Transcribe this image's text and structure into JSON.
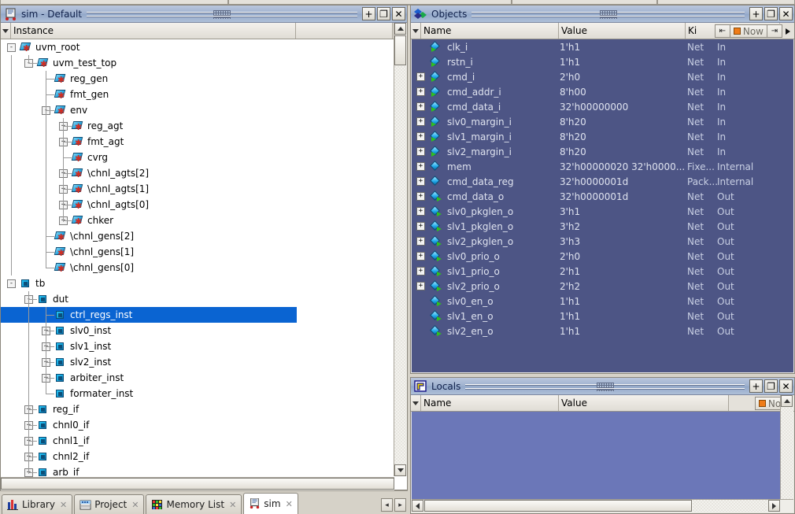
{
  "window": {
    "sim_panel": {
      "title": "sim - Default",
      "icon": "sim-waveform-icon",
      "buttons": [
        {
          "name": "dock-button",
          "glyph": "+"
        },
        {
          "name": "undock-button",
          "glyph": "❐"
        },
        {
          "name": "close-button",
          "glyph": "✕"
        }
      ],
      "columns": [
        "Instance",
        ""
      ],
      "tree": [
        {
          "label": "uvm_root",
          "depth": 0,
          "expander": "-",
          "icon": "uvm-class-icon"
        },
        {
          "label": "uvm_test_top",
          "depth": 1,
          "expander": "-",
          "icon": "uvm-class-icon"
        },
        {
          "label": "reg_gen",
          "depth": 2,
          "expander": "",
          "icon": "uvm-class-icon"
        },
        {
          "label": "fmt_gen",
          "depth": 2,
          "expander": "",
          "icon": "uvm-class-icon"
        },
        {
          "label": "env",
          "depth": 2,
          "expander": "-",
          "icon": "uvm-class-icon"
        },
        {
          "label": "reg_agt",
          "depth": 3,
          "expander": "+",
          "icon": "uvm-class-icon"
        },
        {
          "label": "fmt_agt",
          "depth": 3,
          "expander": "+",
          "icon": "uvm-class-icon"
        },
        {
          "label": "cvrg",
          "depth": 3,
          "expander": "",
          "icon": "uvm-class-icon"
        },
        {
          "label": "\\chnl_agts[2]",
          "depth": 3,
          "expander": "+",
          "icon": "uvm-class-icon"
        },
        {
          "label": "\\chnl_agts[1]",
          "depth": 3,
          "expander": "+",
          "icon": "uvm-class-icon"
        },
        {
          "label": "\\chnl_agts[0]",
          "depth": 3,
          "expander": "+",
          "icon": "uvm-class-icon"
        },
        {
          "label": "chker",
          "depth": 3,
          "expander": "+",
          "icon": "uvm-class-icon"
        },
        {
          "label": "\\chnl_gens[2]",
          "depth": 2,
          "expander": "",
          "icon": "uvm-class-icon"
        },
        {
          "label": "\\chnl_gens[1]",
          "depth": 2,
          "expander": "",
          "icon": "uvm-class-icon"
        },
        {
          "label": "\\chnl_gens[0]",
          "depth": 2,
          "expander": "",
          "icon": "uvm-class-icon"
        },
        {
          "label": "tb",
          "depth": 0,
          "expander": "-",
          "icon": "module-icon"
        },
        {
          "label": "dut",
          "depth": 1,
          "expander": "-",
          "icon": "module-icon"
        },
        {
          "label": "ctrl_regs_inst",
          "depth": 2,
          "expander": "",
          "icon": "module-icon",
          "selected": true
        },
        {
          "label": "slv0_inst",
          "depth": 2,
          "expander": "+",
          "icon": "module-icon"
        },
        {
          "label": "slv1_inst",
          "depth": 2,
          "expander": "+",
          "icon": "module-icon"
        },
        {
          "label": "slv2_inst",
          "depth": 2,
          "expander": "+",
          "icon": "module-icon"
        },
        {
          "label": "arbiter_inst",
          "depth": 2,
          "expander": "+",
          "icon": "module-icon"
        },
        {
          "label": "formater_inst",
          "depth": 2,
          "expander": "",
          "icon": "module-icon"
        },
        {
          "label": "reg_if",
          "depth": 1,
          "expander": "+",
          "icon": "module-icon"
        },
        {
          "label": "chnl0_if",
          "depth": 1,
          "expander": "+",
          "icon": "module-icon"
        },
        {
          "label": "chnl1_if",
          "depth": 1,
          "expander": "+",
          "icon": "module-icon"
        },
        {
          "label": "chnl2_if",
          "depth": 1,
          "expander": "+",
          "icon": "module-icon"
        },
        {
          "label": "arb_if",
          "depth": 1,
          "expander": "+",
          "icon": "module-icon"
        }
      ]
    },
    "objects_panel": {
      "title": "Objects",
      "icon": "objects-diamond-icon",
      "buttons": [
        {
          "name": "dock-button",
          "glyph": "+"
        },
        {
          "name": "undock-button",
          "glyph": "❐"
        },
        {
          "name": "close-button",
          "glyph": "✕"
        }
      ],
      "columns": [
        "Name",
        "Value",
        "Ki"
      ],
      "now_toolbar": {
        "prev_transition": "⇤",
        "next_transition": "⇥",
        "label": "Now",
        "marker_color": "#ef7c18",
        "overflow": "▶"
      },
      "rows": [
        {
          "name": "clk_i",
          "value": "1'h1",
          "kind": "Net",
          "mode": "In",
          "expander": "",
          "icon": "net-in-icon"
        },
        {
          "name": "rstn_i",
          "value": "1'h1",
          "kind": "Net",
          "mode": "In",
          "expander": "",
          "icon": "net-in-icon"
        },
        {
          "name": "cmd_i",
          "value": "2'h0",
          "kind": "Net",
          "mode": "In",
          "expander": "+",
          "icon": "net-in-icon"
        },
        {
          "name": "cmd_addr_i",
          "value": "8'h00",
          "kind": "Net",
          "mode": "In",
          "expander": "+",
          "icon": "net-in-icon"
        },
        {
          "name": "cmd_data_i",
          "value": "32'h00000000",
          "kind": "Net",
          "mode": "In",
          "expander": "+",
          "icon": "net-in-icon"
        },
        {
          "name": "slv0_margin_i",
          "value": "8'h20",
          "kind": "Net",
          "mode": "In",
          "expander": "+",
          "icon": "net-in-icon"
        },
        {
          "name": "slv1_margin_i",
          "value": "8'h20",
          "kind": "Net",
          "mode": "In",
          "expander": "+",
          "icon": "net-in-icon"
        },
        {
          "name": "slv2_margin_i",
          "value": "8'h20",
          "kind": "Net",
          "mode": "In",
          "expander": "+",
          "icon": "net-in-icon"
        },
        {
          "name": "mem",
          "value": "32'h00000020 32'h0000...",
          "kind": "Fixe...",
          "mode": "Internal",
          "expander": "+",
          "icon": "variable-icon"
        },
        {
          "name": "cmd_data_reg",
          "value": "32'h0000001d",
          "kind": "Pack...",
          "mode": "Internal",
          "expander": "+",
          "icon": "variable-icon"
        },
        {
          "name": "cmd_data_o",
          "value": "32'h0000001d",
          "kind": "Net",
          "mode": "Out",
          "expander": "+",
          "icon": "net-out-icon"
        },
        {
          "name": "slv0_pkglen_o",
          "value": "3'h1",
          "kind": "Net",
          "mode": "Out",
          "expander": "+",
          "icon": "net-out-icon"
        },
        {
          "name": "slv1_pkglen_o",
          "value": "3'h2",
          "kind": "Net",
          "mode": "Out",
          "expander": "+",
          "icon": "net-out-icon"
        },
        {
          "name": "slv2_pkglen_o",
          "value": "3'h3",
          "kind": "Net",
          "mode": "Out",
          "expander": "+",
          "icon": "net-out-icon"
        },
        {
          "name": "slv0_prio_o",
          "value": "2'h0",
          "kind": "Net",
          "mode": "Out",
          "expander": "+",
          "icon": "net-out-icon"
        },
        {
          "name": "slv1_prio_o",
          "value": "2'h1",
          "kind": "Net",
          "mode": "Out",
          "expander": "+",
          "icon": "net-out-icon"
        },
        {
          "name": "slv2_prio_o",
          "value": "2'h2",
          "kind": "Net",
          "mode": "Out",
          "expander": "+",
          "icon": "net-out-icon"
        },
        {
          "name": "slv0_en_o",
          "value": "1'h1",
          "kind": "Net",
          "mode": "Out",
          "expander": "",
          "icon": "net-out-icon"
        },
        {
          "name": "slv1_en_o",
          "value": "1'h1",
          "kind": "Net",
          "mode": "Out",
          "expander": "",
          "icon": "net-out-icon"
        },
        {
          "name": "slv2_en_o",
          "value": "1'h1",
          "kind": "Net",
          "mode": "Out",
          "expander": "",
          "icon": "net-out-icon"
        }
      ]
    },
    "locals_panel": {
      "title": "Locals",
      "icon": "locals-icon",
      "buttons": [
        {
          "name": "dock-button",
          "glyph": "+"
        },
        {
          "name": "undock-button",
          "glyph": "❐"
        },
        {
          "name": "close-button",
          "glyph": "✕"
        }
      ],
      "columns": [
        "Name",
        "Value"
      ],
      "now_label": "Now",
      "rows": []
    },
    "tabs": [
      {
        "label": "Library",
        "icon": "library-icon",
        "active": false,
        "close": "✕"
      },
      {
        "label": "Project",
        "icon": "project-icon",
        "active": false,
        "close": "✕"
      },
      {
        "label": "Memory List",
        "icon": "memory-list-icon",
        "active": false,
        "close": "✕"
      },
      {
        "label": "sim",
        "icon": "sim-waveform-icon",
        "active": true,
        "close": "✕"
      }
    ],
    "tab_nav": {
      "prev": "◂",
      "next": "▸"
    }
  },
  "colors": {
    "selection_blue": "#0a64d2",
    "objects_bg": "#4d5585",
    "locals_bg": "#6b77b8",
    "panel_title": "#9fb2cf",
    "chrome": "#d6d2c8",
    "now_marker": "#ef7c18"
  }
}
